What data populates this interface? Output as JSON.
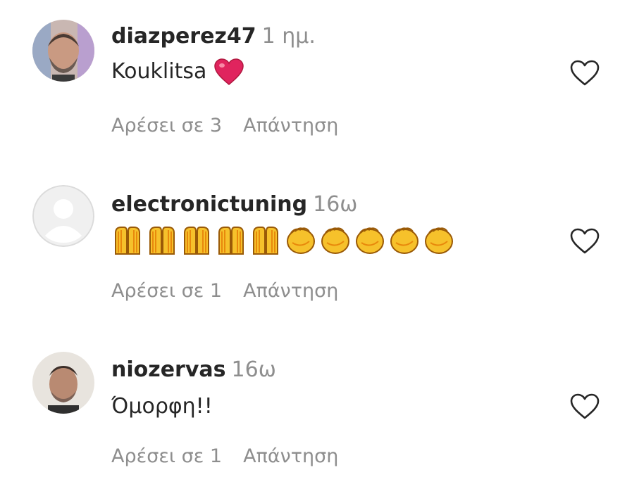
{
  "comments": [
    {
      "username": "diazperez47",
      "time": "1 ημ.",
      "text": "Kouklitsa",
      "text_emojis": [
        "red-heart"
      ],
      "likes": "Αρέσει σε 3",
      "reply": "Απάντηση"
    },
    {
      "username": "electronictuning",
      "time": "16ω",
      "text": "",
      "text_emojis": [
        "raising-hands",
        "raising-hands",
        "raising-hands",
        "raising-hands",
        "raising-hands",
        "clapping-hands",
        "clapping-hands",
        "clapping-hands",
        "clapping-hands",
        "clapping-hands"
      ],
      "likes": "Αρέσει σε 1",
      "reply": "Απάντηση"
    },
    {
      "username": "niozervas",
      "time": "16ω",
      "text": "Όμορφη!!",
      "text_emojis": [],
      "likes": "Αρέσει σε 1",
      "reply": "Απάντηση"
    }
  ],
  "colors": {
    "username": "#262626",
    "secondary_text": "#8e8e8e",
    "heart_red": "#e0245e",
    "emoji_yellow": "#f6c12b",
    "emoji_orange": "#e8890c"
  },
  "icons": {
    "like": "heart-outline-icon"
  }
}
